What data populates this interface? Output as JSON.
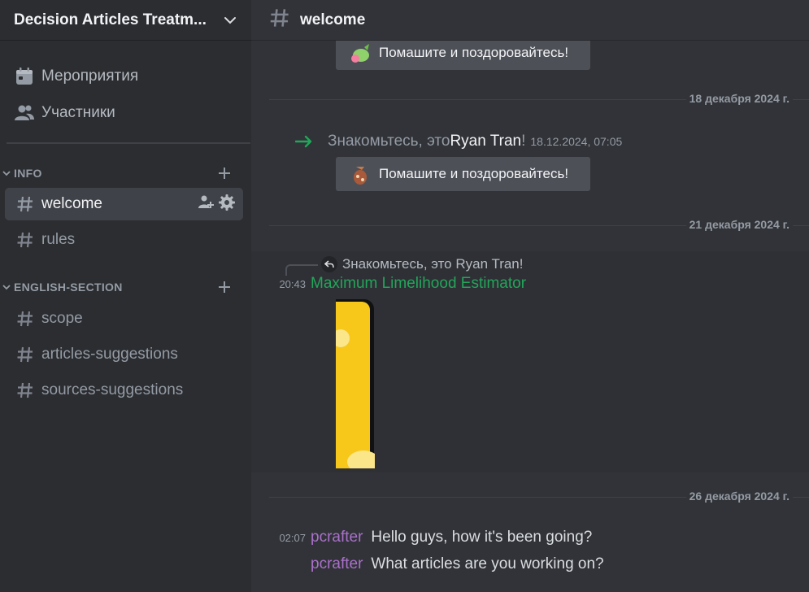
{
  "server": {
    "name": "Decision Articles Treatm..."
  },
  "top_items": [
    {
      "label": "Мероприятия",
      "icon": "calendar-icon"
    },
    {
      "label": "Участники",
      "icon": "members-icon"
    }
  ],
  "categories": [
    {
      "name": "INFO",
      "channels": [
        {
          "name": "welcome",
          "active": true
        },
        {
          "name": "rules",
          "active": false
        }
      ]
    },
    {
      "name": "ENGLISH-SECTION",
      "channels": [
        {
          "name": "scope"
        },
        {
          "name": "articles-suggestions"
        },
        {
          "name": "sources-suggestions"
        }
      ]
    }
  ],
  "channel_header": {
    "title": "welcome"
  },
  "messages": {
    "wave_button_label": "Помашите и поздоровайтесь!",
    "dividers": [
      "18 декабря 2024 г.",
      "21 декабря 2024 г.",
      "26 декабря 2024 г."
    ],
    "join": {
      "prefix": "Знакомьтесь, это ",
      "user": "Ryan Tran",
      "suffix": "!",
      "timestamp": "18.12.2024, 07:05"
    },
    "reply": {
      "referenced": "Знакомьтесь, это Ryan Tran!",
      "time": "20:43",
      "author": "Maximum Limelihood Estimator",
      "author_color": "#23a55a"
    },
    "chat": [
      {
        "time": "02:07",
        "author": "pcrafter",
        "text": "Hello guys, how it's been going?"
      },
      {
        "time": "",
        "author": "pcrafter",
        "text": "What articles are you working on?"
      }
    ],
    "author_color_pcrafter": "#a970c9"
  },
  "colors": {
    "accent_green": "#23a55a",
    "sidebar_bg": "#2b2d31",
    "main_bg": "#313338",
    "sticker_yellow": "#f7c81a"
  }
}
